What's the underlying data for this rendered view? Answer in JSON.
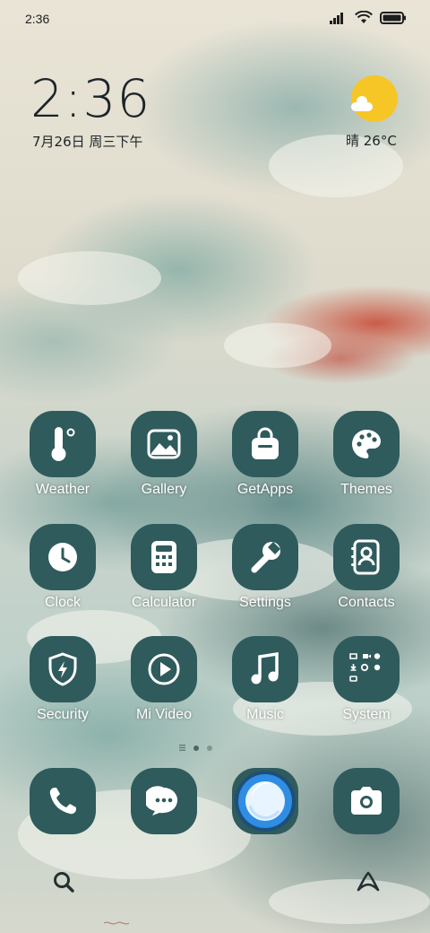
{
  "status_bar": {
    "time": "2:36",
    "icons": [
      "signal-icon",
      "wifi-icon",
      "battery-icon"
    ]
  },
  "clock_widget": {
    "time": "2:36",
    "date": "7月26日 周三下午"
  },
  "weather_widget": {
    "condition_icon": "sun-cloud-icon",
    "text": "晴 26°C"
  },
  "apps": [
    {
      "label": "Weather",
      "icon": "thermometer-icon"
    },
    {
      "label": "Gallery",
      "icon": "image-icon"
    },
    {
      "label": "GetApps",
      "icon": "shopping-bag-icon"
    },
    {
      "label": "Themes",
      "icon": "palette-icon"
    },
    {
      "label": "Clock",
      "icon": "clock-icon"
    },
    {
      "label": "Calculator",
      "icon": "calculator-icon"
    },
    {
      "label": "Settings",
      "icon": "wrench-icon"
    },
    {
      "label": "Contacts",
      "icon": "contacts-book-icon"
    },
    {
      "label": "Security",
      "icon": "shield-icon"
    },
    {
      "label": "Mi Video",
      "icon": "play-icon"
    },
    {
      "label": "Music",
      "icon": "music-note-icon"
    },
    {
      "label": "System",
      "icon": "system-folder-icon"
    }
  ],
  "dock": [
    {
      "name": "phone",
      "icon": "phone-icon"
    },
    {
      "name": "messaging",
      "icon": "chat-bubble-icon"
    },
    {
      "name": "browser",
      "icon": "browser-icon"
    },
    {
      "name": "camera",
      "icon": "camera-icon"
    }
  ],
  "page_indicator": {
    "pages": 2,
    "current": 1
  },
  "bottom_bar": {
    "left_icon": "search-icon",
    "right_icon": "assistant-icon"
  },
  "colors": {
    "tile": "#2f5b5c",
    "icon_fg": "#ffffff",
    "sun": "#f6c627",
    "browser_blue": "#2f8de4"
  }
}
